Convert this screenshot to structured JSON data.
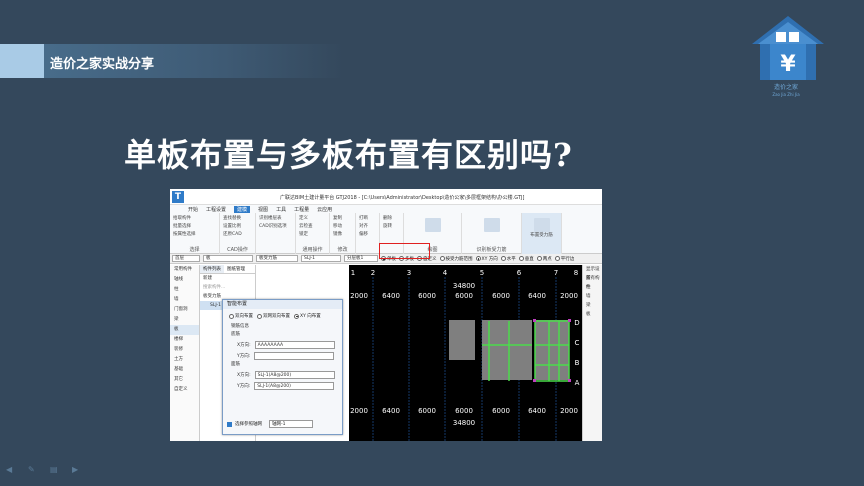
{
  "brand": {
    "label": "造价之家实战分享"
  },
  "logo": {
    "text": "造价之家",
    "sub": "Zao Jia Zhi Jia"
  },
  "headline": "单板布置与多板布置有区别吗?",
  "app": {
    "window_title": "广联达BIM土建计量平台 GTJ2018 - [C:\\Users\\Administrator\\Desktop\\造价公家\\多层框架结构\\办公楼.GTJ]",
    "ribbon_tabs": [
      "开始",
      "工程设置",
      "建模",
      "视图",
      "工具",
      "工程量",
      "云应用"
    ],
    "ribbon_active_tab": "建模",
    "ribbon_groups": [
      {
        "cap": "选择",
        "items": [
          "拾取构件",
          "批量选择",
          "按属性选择"
        ]
      },
      {
        "cap": "CAD操作",
        "items": [
          "查找替换",
          "设置比例",
          "还原CAD"
        ]
      },
      {
        "cap": "",
        "items": [
          "识别楼层表",
          "CAD识别选项"
        ]
      },
      {
        "cap": "通用操作",
        "items": [
          "定义",
          "云检查",
          "锁定"
        ]
      },
      {
        "cap": "修改",
        "items": [
          "复制",
          "移动",
          "镜像"
        ]
      },
      {
        "cap": "",
        "items": [
          "打断",
          "对齐",
          "偏移"
        ]
      },
      {
        "cap": "",
        "items": [
          "删除",
          "旋转"
        ]
      },
      {
        "cap": "绘图",
        "items": []
      },
      {
        "cap": "识别板受力筋",
        "items": []
      },
      {
        "cap": "",
        "items": [
          "布置受力筋"
        ]
      }
    ],
    "toolbar": {
      "sel1": "首层",
      "sel2": "板",
      "sel3": "板受力筋",
      "sel4": "SLJ-1",
      "sel5": "分层板1",
      "opt_single": "单板",
      "opt_multi": "多板",
      "opt_custom": "自定义",
      "opt_range": "按受力筋范围",
      "opt_xy": "XY 方向",
      "opt_h": "水平",
      "opt_v": "垂直",
      "opt_two": "两点",
      "opt_parallel": "平行边"
    },
    "left_nav": [
      "常用构件",
      "轴线",
      "柱",
      "墙",
      "门窗洞",
      "梁",
      "板",
      "楼梯",
      "装修",
      "土方",
      "基础",
      "其它",
      "自定义"
    ],
    "tree": {
      "tabs": [
        "构件列表",
        "图纸管理"
      ],
      "new_label": "新建",
      "search_placeholder": "搜索构件...",
      "group": "板受力筋",
      "item": "SLJ-1"
    },
    "dialog": {
      "title": "智能布置",
      "options": [
        "双向布置",
        "双网双向布置",
        "XY 向布置"
      ],
      "selected_option": "XY 向布置",
      "rebar_info": "钢筋信息",
      "bottom_bar": "底筋",
      "x_label": "X方向:",
      "x_value": "AAAAAAAA",
      "y_label": "Y方向:",
      "y_value": "",
      "top_bar": "面筋",
      "top_x_label": "X方向:",
      "top_x_value": "SLJ-1(A8@200)",
      "top_y_label": "Y方向:",
      "top_y_value": "SLJ-1(A8@200)",
      "ref_label": "选择参照轴网",
      "ref_value": "轴网-1"
    },
    "drawing": {
      "axis_labels": [
        "1",
        "2",
        "3",
        "4",
        "5",
        "6",
        "7",
        "8"
      ],
      "dims": [
        "2000",
        "6400",
        "6000",
        "6000",
        "6000",
        "6400",
        "2000"
      ],
      "total": "34800",
      "right_labels": [
        "D",
        "C",
        "B",
        "A"
      ],
      "right_panel": [
        "显示设置",
        "所有构件",
        "柱",
        "墙",
        "梁",
        "板"
      ]
    }
  }
}
